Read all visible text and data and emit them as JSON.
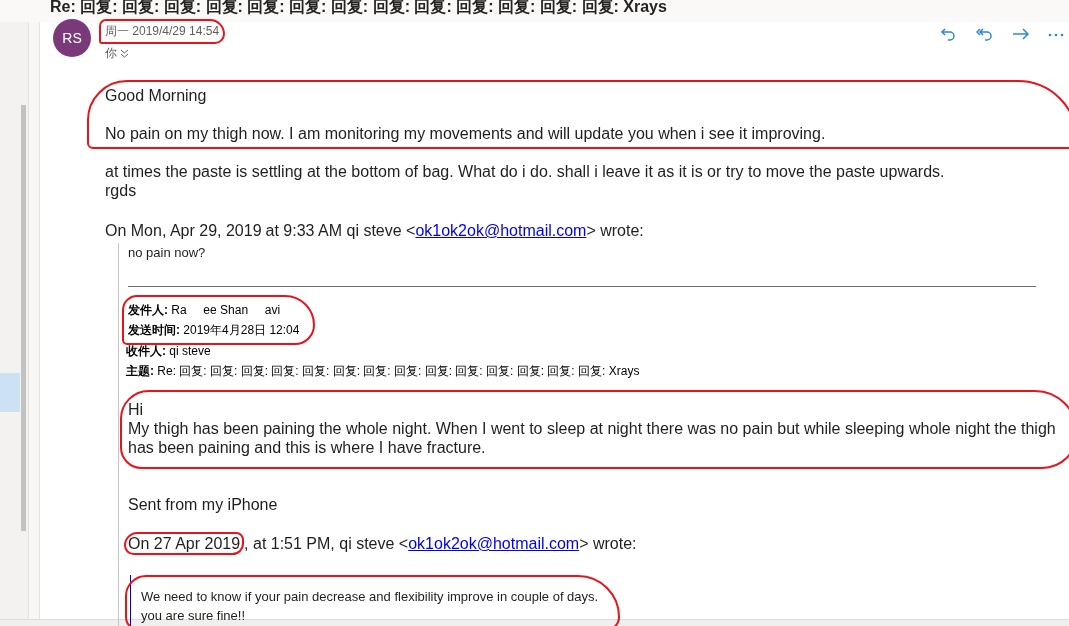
{
  "subject": "Re: 回复: 回复: 回复: 回复: 回复: 回复: 回复: 回复: 回复: 回复: 回复: 回复: 回复: Xrays",
  "sidebar": {
    "items": [
      {
        "selected": true
      }
    ]
  },
  "message": {
    "avatar_initials": "RS",
    "date": {
      "text": "周一 2019/4/29 14:54",
      "annotated": true
    },
    "recipient": "你",
    "blocks": [
      {
        "kind": "paragraph",
        "annotated": true,
        "paragraphs": [
          [
            "Good Morning"
          ],
          [
            "No pain on my thigh now. I am monitoring my movements and will update you when i see it improving."
          ]
        ]
      },
      {
        "kind": "paragraph",
        "annotated": false,
        "paragraphs": [
          [
            "at times the paste is settling at the bottom of bag. What do i do. shall i leave it as it is or try to move the paste upwards.",
            "rgds"
          ]
        ]
      }
    ],
    "attribution": {
      "date": "On Mon, Apr 29, 2019",
      "date_annotated": false,
      "before": " at 9:33 AM qi steve <",
      "link": "ok1ok2ok@hotmail.com",
      "after": "> wrote:"
    },
    "quote": {
      "first_line": "no pain now?",
      "header_group_annotated": true,
      "headers": [
        {
          "label": "发件人:",
          "value": "Ra     ee Shan     avi"
        },
        {
          "label": "发送时间:",
          "value": "2019年4月28日 12:04"
        },
        {
          "label": "收件人:",
          "value": "qi steve"
        },
        {
          "label": "主题:",
          "value": "Re: 回复: 回复: 回复: 回复: 回复: 回复: 回复: 回复: 回复: 回复: 回复: 回复: 回复: 回复: Xrays"
        }
      ],
      "body": {
        "annotated": true,
        "lines": [
          "Hi",
          "My thigh has been paining the whole night. When I went to sleep at night there was no pain but while sleeping whole night the thigh has been paining and this is where I have fracture."
        ]
      },
      "signature": "Sent from my iPhone",
      "attribution": {
        "date": "On 27 Apr 2019",
        "date_annotated": true,
        "before": ", at 1:51 PM, qi steve <",
        "link": "ok1ok2ok@hotmail.com",
        "after": "> wrote:"
      },
      "inner_quote": {
        "annotated": true,
        "lines": [
          "We need to know if your pain decrease and flexibility improve in couple of days.",
          "you are sure fine!!"
        ]
      }
    }
  }
}
